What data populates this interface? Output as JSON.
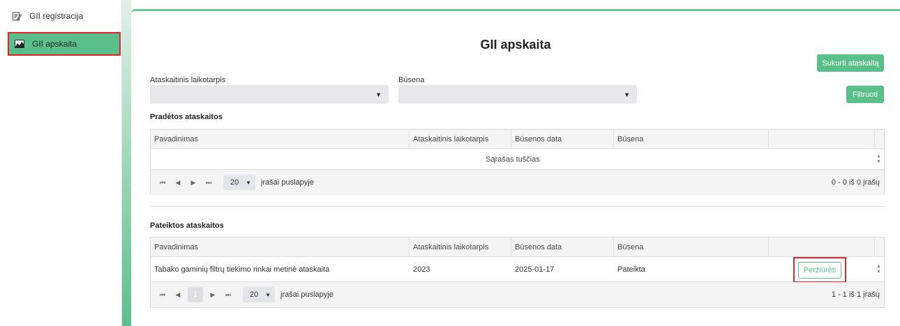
{
  "sidebar": {
    "items": [
      {
        "label": "GII registracija",
        "icon": "edit-document-icon"
      },
      {
        "label": "GII apskaita",
        "icon": "chart-icon"
      }
    ]
  },
  "page": {
    "title": "GII apskaita",
    "create_button": "Sukurti ataskaitą",
    "filter_button": "Filtruoti"
  },
  "filters": {
    "period_label": "Ataskaitinis laikotarpis",
    "period_value": "",
    "status_label": "Būsena",
    "status_value": ""
  },
  "started": {
    "title": "Pradėtos ataskaitos",
    "columns": [
      "Pavadinimas",
      "Ataskaitinis laikotarpis",
      "Būsenos data",
      "Būsena",
      ""
    ],
    "empty_text": "Sąrašas tuščias",
    "pager": {
      "page_size": "20",
      "per_page_label": "įrašai puslapyje",
      "info": "0 - 0 iš 0 įrašų"
    }
  },
  "submitted": {
    "title": "Pateiktos ataskaitos",
    "columns": [
      "Pavadinimas",
      "Ataskaitinis laikotarpis",
      "Būsenos data",
      "Būsena",
      ""
    ],
    "rows": [
      {
        "name": "Tabako gaminių filtrų tiekimo rinkai metinė ataskaita",
        "period": "2023",
        "date": "2025-01-17",
        "status": "Pateikta",
        "action": "Peržiūrėti"
      }
    ],
    "pager": {
      "current_page": "1",
      "page_size": "20",
      "per_page_label": "įrašai puslapyje",
      "info": "1 - 1 iš 1 įrašų"
    }
  },
  "colors": {
    "accent": "#5bbf8b",
    "highlight": "#e0242a"
  }
}
